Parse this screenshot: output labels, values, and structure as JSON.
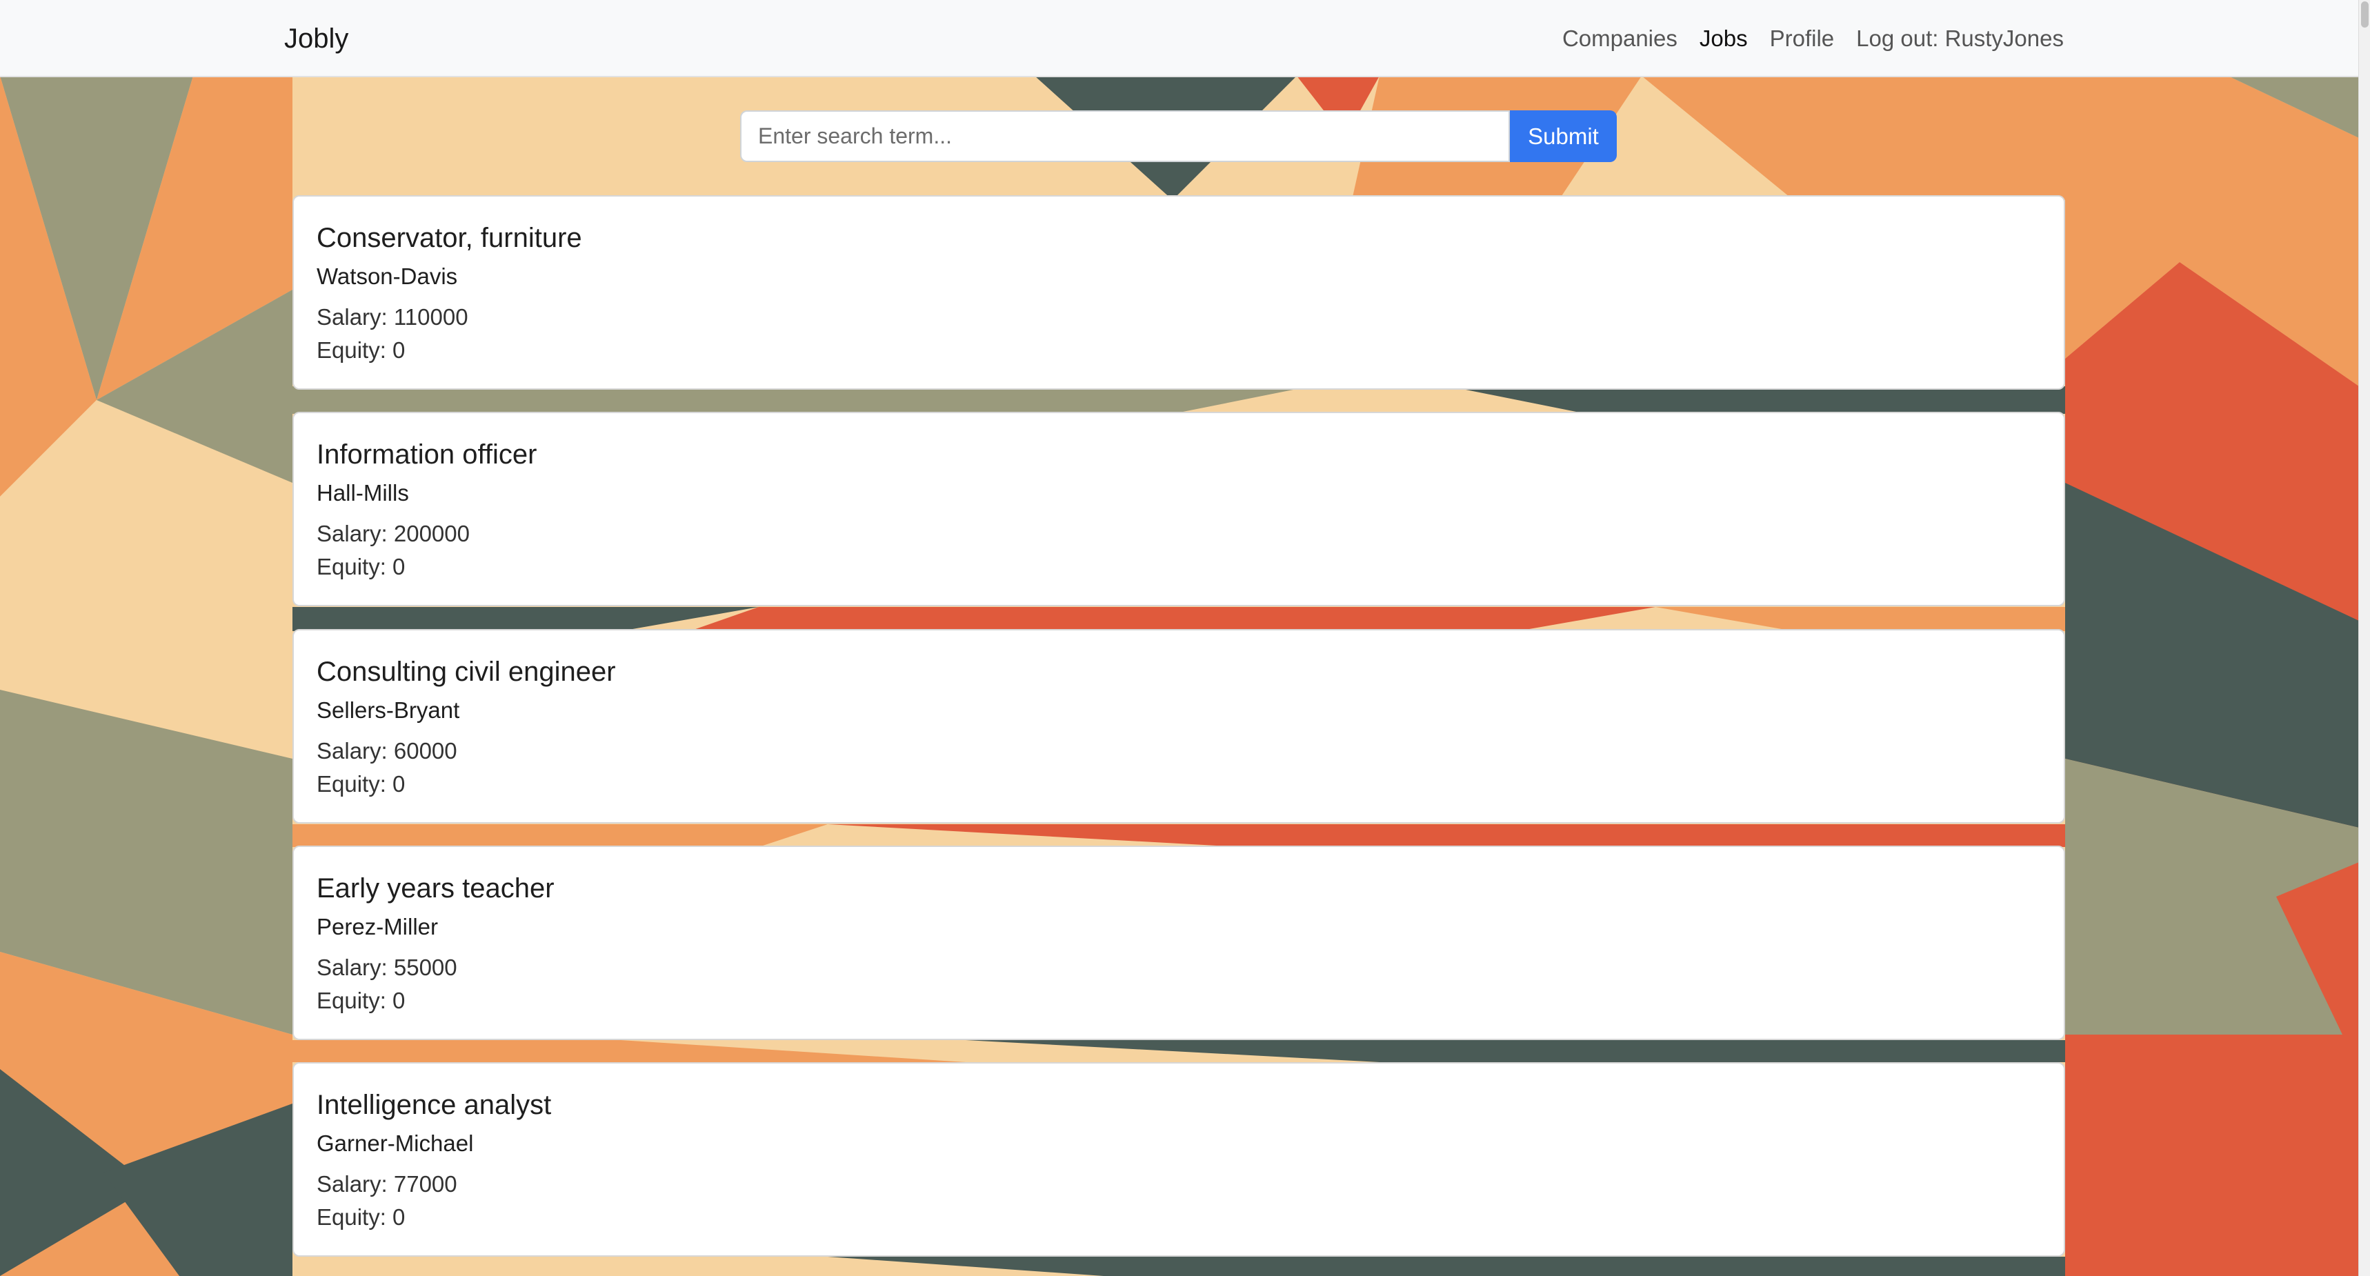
{
  "app": {
    "brand": "Jobly"
  },
  "nav": {
    "companies": "Companies",
    "jobs": "Jobs",
    "profile": "Profile",
    "logout": "Log out: RustyJones"
  },
  "search": {
    "placeholder": "Enter search term...",
    "value": "",
    "submit_label": "Submit"
  },
  "jobs": [
    {
      "title": "Conservator, furniture",
      "company": "Watson-Davis",
      "salary": "Salary: 110000",
      "equity": "Equity: 0"
    },
    {
      "title": "Information officer",
      "company": "Hall-Mills",
      "salary": "Salary: 200000",
      "equity": "Equity: 0"
    },
    {
      "title": "Consulting civil engineer",
      "company": "Sellers-Bryant",
      "salary": "Salary: 60000",
      "equity": "Equity: 0"
    },
    {
      "title": "Early years teacher",
      "company": "Perez-Miller",
      "salary": "Salary: 55000",
      "equity": "Equity: 0"
    },
    {
      "title": "Intelligence analyst",
      "company": "Garner-Michael",
      "salary": "Salary: 77000",
      "equity": "Equity: 0"
    }
  ],
  "colors": {
    "accent": "#3276f0",
    "pattern": [
      "#4a5b56",
      "#9a9a7c",
      "#f09c5c",
      "#f6d39f",
      "#e05a3c"
    ]
  }
}
